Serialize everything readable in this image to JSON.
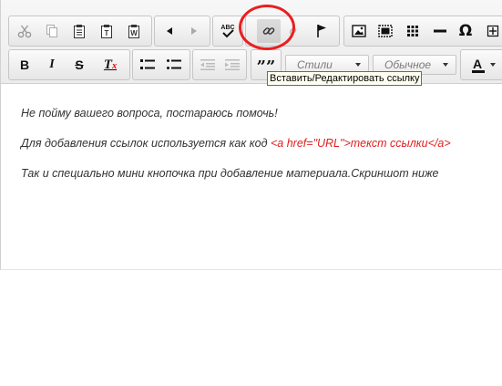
{
  "toolbar": {
    "row1": [
      {
        "name": "cut-button",
        "icon": "scissors-icon"
      },
      {
        "name": "copy-button",
        "icon": "copy-icon"
      },
      {
        "name": "paste-button",
        "icon": "clipboard-icon"
      },
      {
        "name": "paste-text-button",
        "icon": "paste-text-icon"
      },
      {
        "name": "paste-word-button",
        "icon": "paste-word-icon"
      },
      {
        "name": "undo-button",
        "icon": "undo-icon"
      },
      {
        "name": "redo-button",
        "icon": "redo-icon"
      },
      {
        "name": "spellcheck-button",
        "icon": "abc-check-icon"
      },
      {
        "name": "link-button",
        "icon": "link-icon"
      },
      {
        "name": "unlink-button",
        "icon": "unlink-icon"
      },
      {
        "name": "anchor-button",
        "icon": "flag-icon"
      },
      {
        "name": "image-button",
        "icon": "image-icon"
      },
      {
        "name": "flash-button",
        "icon": "flash-icon"
      },
      {
        "name": "table-button",
        "icon": "table-icon"
      },
      {
        "name": "horizontal-line-button",
        "icon": "horizontal-line-icon"
      },
      {
        "name": "special-char-button",
        "icon": "omega-icon"
      },
      {
        "name": "maximize-button",
        "icon": "plus-icon"
      }
    ],
    "row2": [
      {
        "name": "bold-button",
        "icon": "bold-icon"
      },
      {
        "name": "italic-button",
        "icon": "italic-icon"
      },
      {
        "name": "strike-button",
        "icon": "strikethrough-icon"
      },
      {
        "name": "remove-format-button",
        "icon": "remove-format-icon"
      },
      {
        "name": "numbered-list-button",
        "icon": "numbered-list-icon"
      },
      {
        "name": "bulleted-list-button",
        "icon": "bulleted-list-icon"
      },
      {
        "name": "outdent-button",
        "icon": "outdent-icon"
      },
      {
        "name": "indent-button",
        "icon": "indent-icon"
      },
      {
        "name": "blockquote-button",
        "icon": "quote-icon"
      }
    ],
    "styles_combo": {
      "value": "Стили"
    },
    "format_combo": {
      "value": "Обычное"
    },
    "text_color": {
      "label": "A"
    },
    "bold_label": "B",
    "italic_label": "I",
    "strike_label": "S",
    "remove_format_label": "T",
    "remove_format_sub": "x",
    "quote_label": "””",
    "omega_label": "Ω",
    "spell_label": "ABC"
  },
  "tooltip": {
    "text": "Вставить/Редактировать ссылку"
  },
  "content": {
    "p1": "Не пойму вашего вопроса, постараюсь помочь!",
    "p2_text": "Для добавления ссылок используется как код ",
    "p2_code": "<a href=\"URL\">текст ссылки</a>",
    "p3": "Так и специально мини кнопочка при добавление материала.Скриншот ниже"
  },
  "colors": {
    "annotation": "#ea1f1f",
    "code": "#e02020"
  }
}
